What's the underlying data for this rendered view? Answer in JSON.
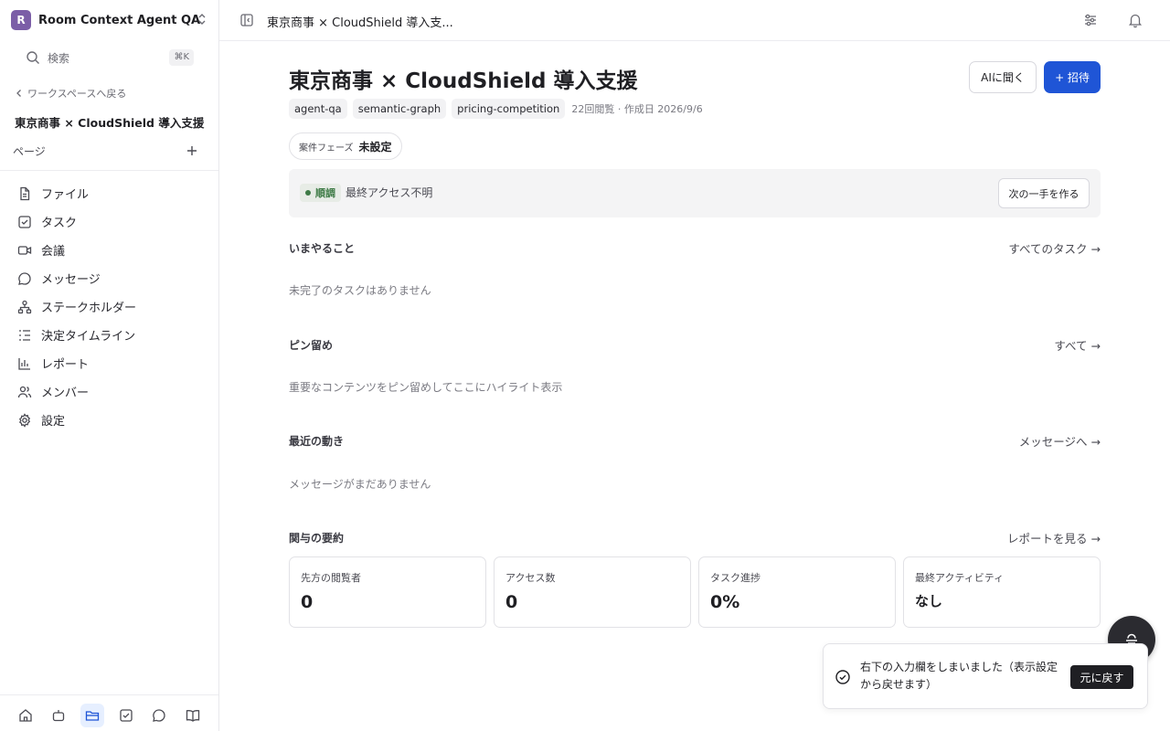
{
  "workspace": {
    "initial": "R",
    "name": "Room Context Agent QA",
    "avatar_color": "#7b5ea7"
  },
  "search": {
    "placeholder": "検索",
    "shortcut": "⌘K"
  },
  "sidebar": {
    "back_label": "ワークスペースへ戻る",
    "room_title": "東京商事 × CloudShield 導入支援",
    "pages_label": "ページ",
    "items": [
      {
        "label": "ファイル",
        "icon": "file-icon"
      },
      {
        "label": "タスク",
        "icon": "checkbox-icon"
      },
      {
        "label": "会議",
        "icon": "video-icon"
      },
      {
        "label": "メッセージ",
        "icon": "chat-icon"
      },
      {
        "label": "ステークホルダー",
        "icon": "hierarchy-icon"
      },
      {
        "label": "決定タイムライン",
        "icon": "timeline-icon"
      },
      {
        "label": "レポート",
        "icon": "bar-chart-icon"
      },
      {
        "label": "メンバー",
        "icon": "users-icon"
      },
      {
        "label": "設定",
        "icon": "gear-icon"
      }
    ],
    "bottom_icons": [
      "home-icon",
      "bot-icon",
      "folder-icon",
      "task-icon",
      "chat-icon",
      "book-icon"
    ],
    "active_bottom": "folder-icon"
  },
  "header": {
    "breadcrumb": "東京商事 × CloudShield 導入支...",
    "icons": [
      "sliders-icon",
      "bell-icon"
    ]
  },
  "main": {
    "title": "東京商事 × CloudShield 導入支援",
    "ask_ai_label": "AIに聞く",
    "invite_label": "+ 招待",
    "tags": [
      "agent-qa",
      "semantic-graph",
      "pricing-competition"
    ],
    "meta": "22回閲覧 · 作成日 2026/9/6",
    "phase_label": "案件フェーズ",
    "phase_value": "未設定",
    "status": {
      "badge": "順調",
      "text": "最終アクセス不明",
      "next_button": "次の一手を作る",
      "color": "#3d7a45"
    },
    "sections": {
      "todo": {
        "title": "いまやること",
        "link": "すべてのタスク →",
        "empty": "未完了のタスクはありません"
      },
      "pinned": {
        "title": "ピン留め",
        "link": "すべて →",
        "empty": "重要なコンテンツをピン留めしてここにハイライト表示"
      },
      "recent": {
        "title": "最近の動き",
        "link": "メッセージへ →",
        "empty": "メッセージがまだありません"
      },
      "engagement": {
        "title": "関与の要約",
        "link": "レポートを見る →"
      }
    },
    "stats": [
      {
        "label": "先方の閲覧者",
        "value": "0"
      },
      {
        "label": "アクセス数",
        "value": "0"
      },
      {
        "label": "タスク進捗",
        "value": "0%"
      },
      {
        "label": "最終アクティビティ",
        "value": "なし"
      }
    ]
  },
  "toast": {
    "message": "右下の入力欄をしまいました（表示設定から戻せます）",
    "undo_label": "元に戻す"
  },
  "colors": {
    "primary": "#1f55d6",
    "text": "#1f1f23",
    "muted": "#7a7a82"
  }
}
